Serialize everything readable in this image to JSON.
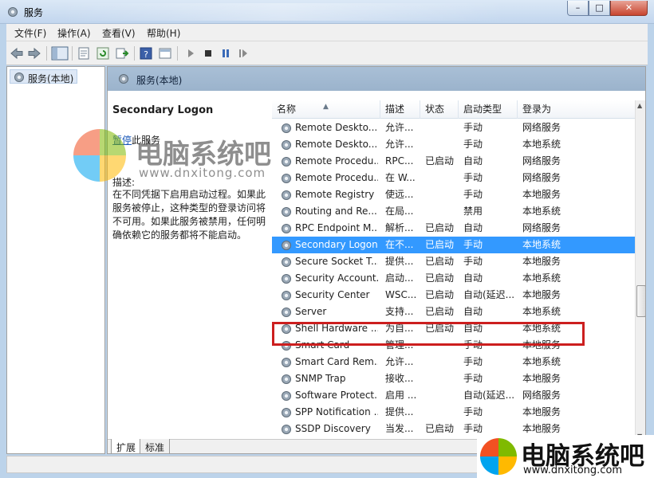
{
  "window": {
    "title": "服务"
  },
  "menu": [
    "文件(F)",
    "操作(A)",
    "查看(V)",
    "帮助(H)"
  ],
  "toolbar_icons": [
    "back-arrow-icon",
    "forward-arrow-icon",
    "console-tree-icon",
    "properties-icon",
    "refresh-icon",
    "export-list-icon",
    "help-icon",
    "show-hide-icon",
    "play-icon",
    "stop-icon",
    "pause-icon",
    "resume-icon"
  ],
  "tree": {
    "root": "服务(本地)"
  },
  "content": {
    "header": "服务(本地)"
  },
  "desc": {
    "service_name": "Secondary Logon",
    "stop_link": "暂停",
    "stop_rest": "此服务",
    "desc_label": "描述:",
    "desc_text": "在不同凭据下启用启动过程。如果此服务被停止，这种类型的登录访问将不可用。如果此服务被禁用，任何明确依赖它的服务都将不能启动。"
  },
  "columns": [
    "名称",
    "描述",
    "状态",
    "启动类型",
    "登录为"
  ],
  "rows": [
    {
      "name": "Remote Deskto...",
      "desc": "允许...",
      "status": "",
      "startup": "手动",
      "logon": "网络服务"
    },
    {
      "name": "Remote Deskto...",
      "desc": "允许...",
      "status": "",
      "startup": "手动",
      "logon": "本地系统"
    },
    {
      "name": "Remote Procedu...",
      "desc": "RPC...",
      "status": "已启动",
      "startup": "自动",
      "logon": "网络服务"
    },
    {
      "name": "Remote Procedu...",
      "desc": "在 W...",
      "status": "",
      "startup": "手动",
      "logon": "网络服务"
    },
    {
      "name": "Remote Registry",
      "desc": "使远...",
      "status": "",
      "startup": "手动",
      "logon": "本地服务"
    },
    {
      "name": "Routing and Re...",
      "desc": "在局...",
      "status": "",
      "startup": "禁用",
      "logon": "本地系统"
    },
    {
      "name": "RPC Endpoint M...",
      "desc": "解析...",
      "status": "已启动",
      "startup": "自动",
      "logon": "网络服务"
    },
    {
      "name": "Secondary Logon",
      "desc": "在不...",
      "status": "已启动",
      "startup": "手动",
      "logon": "本地系统"
    },
    {
      "name": "Secure Socket T...",
      "desc": "提供...",
      "status": "已启动",
      "startup": "手动",
      "logon": "本地服务"
    },
    {
      "name": "Security Account...",
      "desc": "启动...",
      "status": "已启动",
      "startup": "自动",
      "logon": "本地系统"
    },
    {
      "name": "Security Center",
      "desc": "WSC...",
      "status": "已启动",
      "startup": "自动(延迟...",
      "logon": "本地服务"
    },
    {
      "name": "Server",
      "desc": "支持...",
      "status": "已启动",
      "startup": "自动",
      "logon": "本地系统"
    },
    {
      "name": "Shell Hardware ...",
      "desc": "为自...",
      "status": "已启动",
      "startup": "自动",
      "logon": "本地系统"
    },
    {
      "name": "Smart Card",
      "desc": "管理...",
      "status": "",
      "startup": "手动",
      "logon": "本地服务"
    },
    {
      "name": "Smart Card Rem...",
      "desc": "允许...",
      "status": "",
      "startup": "手动",
      "logon": "本地系统"
    },
    {
      "name": "SNMP Trap",
      "desc": "接收...",
      "status": "",
      "startup": "手动",
      "logon": "本地服务"
    },
    {
      "name": "Software Protect...",
      "desc": "启用 ...",
      "status": "",
      "startup": "自动(延迟...",
      "logon": "网络服务"
    },
    {
      "name": "SPP Notification ...",
      "desc": "提供...",
      "status": "",
      "startup": "手动",
      "logon": "本地服务"
    },
    {
      "name": "SSDP Discovery",
      "desc": "当发...",
      "status": "已启动",
      "startup": "手动",
      "logon": "本地服务"
    }
  ],
  "selected_row_index": 7,
  "tabs": [
    "扩展",
    "标准"
  ],
  "watermark": {
    "cn": "电脑系统吧",
    "url": "www.dnxitong.com"
  },
  "colors": {
    "selection": "#3399ff",
    "highlight_box": "#cc1f1f",
    "link": "#1a58b8"
  }
}
